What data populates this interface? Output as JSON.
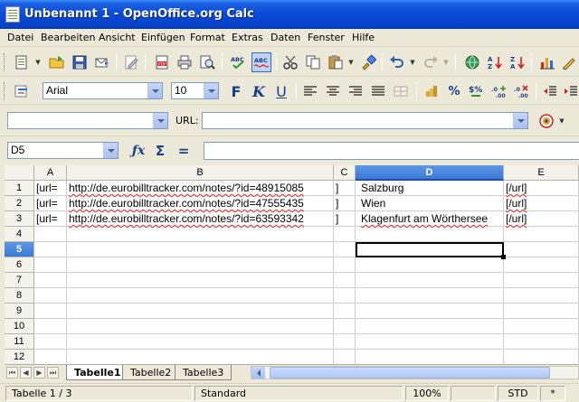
{
  "window": {
    "title": "Unbenannt 1 - OpenOffice.org Calc"
  },
  "menu": [
    "Datei",
    "Bearbeiten",
    "Ansicht",
    "Einfügen",
    "Format",
    "Extras",
    "Daten",
    "Fenster",
    "Hilfe"
  ],
  "format_toolbar": {
    "font_name": "Arial",
    "font_size": "10"
  },
  "hyperlink_bar": {
    "url_label": "URL:",
    "target_value": "",
    "url_value": ""
  },
  "formula_bar": {
    "name_box": "D5",
    "formula": ""
  },
  "grid": {
    "columns": [
      "A",
      "B",
      "C",
      "D",
      "E"
    ],
    "selected_column": "D",
    "rows": [
      "1",
      "2",
      "3",
      "4",
      "5",
      "6",
      "7",
      "8",
      "9",
      "10",
      "11",
      "12"
    ],
    "selected_row": "5",
    "cells": [
      {
        "a": "[url=",
        "b": "http://de.eurobilltracker.com/notes/?id=48915085",
        "c": "]",
        "d": "Salzburg",
        "e": "[/url]"
      },
      {
        "a": "[url=",
        "b": "http://de.eurobilltracker.com/notes/?id=47555435",
        "c": "]",
        "d": "Wien",
        "e": "[/url]"
      },
      {
        "a": "[url=",
        "b": "http://de.eurobilltracker.com/notes/?id=63593342",
        "c": "]",
        "d": "Klagenfurt am Wörthersee",
        "e": "[/url]"
      }
    ]
  },
  "sheet_tabs": [
    "Tabelle1",
    "Tabelle2",
    "Tabelle3"
  ],
  "active_sheet": "Tabelle1",
  "status": {
    "sheet": "Tabelle 1 / 3",
    "style": "Standard",
    "zoom": "100%",
    "mode": "STD",
    "modified": "*"
  }
}
